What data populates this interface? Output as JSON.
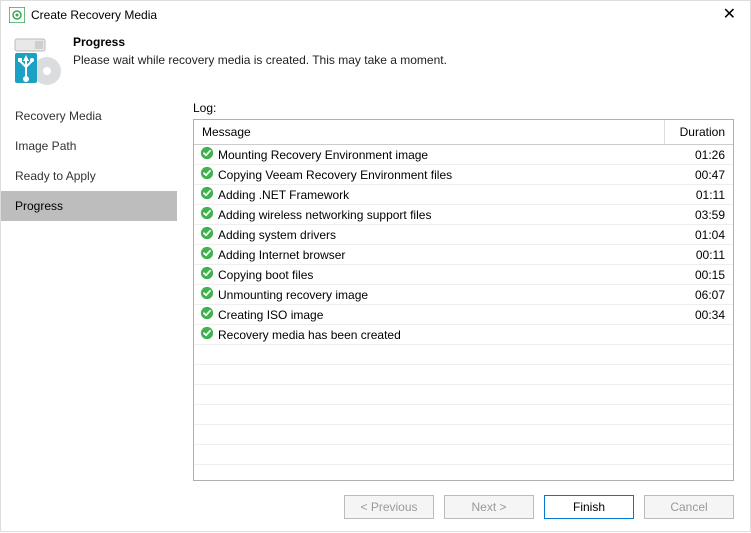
{
  "window": {
    "title": "Create Recovery Media"
  },
  "header": {
    "title": "Progress",
    "subtitle": "Please wait while recovery media is created. This may take a moment."
  },
  "sidebar": {
    "items": [
      {
        "label": "Recovery Media",
        "active": false
      },
      {
        "label": "Image Path",
        "active": false
      },
      {
        "label": "Ready to Apply",
        "active": false
      },
      {
        "label": "Progress",
        "active": true
      }
    ]
  },
  "log": {
    "label": "Log:",
    "columns": {
      "message": "Message",
      "duration": "Duration"
    },
    "rows": [
      {
        "status": "success",
        "message": "Mounting Recovery Environment image",
        "duration": "01:26"
      },
      {
        "status": "success",
        "message": "Copying Veeam Recovery Environment files",
        "duration": "00:47"
      },
      {
        "status": "success",
        "message": "Adding .NET Framework",
        "duration": "01:11"
      },
      {
        "status": "success",
        "message": "Adding wireless networking support files",
        "duration": "03:59"
      },
      {
        "status": "success",
        "message": "Adding system drivers",
        "duration": "01:04"
      },
      {
        "status": "success",
        "message": "Adding Internet browser",
        "duration": "00:11"
      },
      {
        "status": "success",
        "message": "Copying boot files",
        "duration": "00:15"
      },
      {
        "status": "success",
        "message": "Unmounting recovery image",
        "duration": "06:07"
      },
      {
        "status": "success",
        "message": "Creating ISO image",
        "duration": "00:34"
      },
      {
        "status": "success",
        "message": "Recovery media has been created",
        "duration": ""
      }
    ]
  },
  "footer": {
    "previous": "< Previous",
    "next": "Next >",
    "finish": "Finish",
    "cancel": "Cancel"
  }
}
